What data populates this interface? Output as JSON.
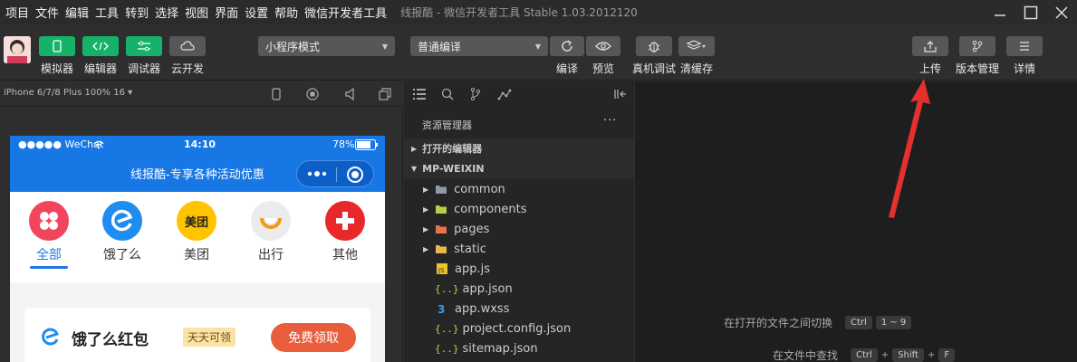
{
  "menubar": {
    "items": [
      "项目",
      "文件",
      "编辑",
      "工具",
      "转到",
      "选择",
      "视图",
      "界面",
      "设置",
      "帮助",
      "微信开发者工具"
    ],
    "window_title": "线报酷 - 微信开发者工具 Stable 1.03.2012120"
  },
  "toolbar": {
    "left_buttons": [
      {
        "label": "模拟器",
        "icon": "phone-icon",
        "color": "#17b26a"
      },
      {
        "label": "编辑器",
        "icon": "code-icon",
        "color": "#17b26a"
      },
      {
        "label": "调试器",
        "icon": "debug-icon",
        "color": "#17b26a"
      },
      {
        "label": "云开发",
        "icon": "cloud-icon",
        "color": "#575757"
      }
    ],
    "mode_select": "小程序模式",
    "compile_select": "普通编译",
    "action_buttons": [
      "编译",
      "预览",
      "真机调试",
      "清缓存"
    ],
    "right_buttons": [
      "上传",
      "版本管理",
      "详情"
    ]
  },
  "simulator": {
    "device": "iPhone 6/7/8 Plus 100% 16 ▾",
    "status": {
      "carrier": "●●●●● WeChat",
      "time": "14:10",
      "battery": "78%"
    },
    "nav_title": "线报酷-专享各种活动优惠",
    "categories": [
      {
        "label": "全部",
        "icon": "all-icon",
        "color": "#f0455c"
      },
      {
        "label": "饿了么",
        "icon": "eleme-icon",
        "color": "#1e8cf0"
      },
      {
        "label": "美团",
        "icon": "meituan-icon",
        "color": "#ffc300",
        "text": "美团"
      },
      {
        "label": "出行",
        "icon": "didi-icon",
        "color": "#f4f4f4"
      },
      {
        "label": "其他",
        "icon": "plus-icon",
        "color": "#e8282b"
      }
    ],
    "card": {
      "title": "饿了么红包",
      "badge": "天天可领",
      "button": "免费领取"
    }
  },
  "explorer": {
    "title": "资源管理器",
    "more": "···",
    "sections": [
      "打开的编辑器",
      "MP-WEIXIN"
    ],
    "tree": [
      {
        "name": "common",
        "type": "folder",
        "color": "#8a9aa8"
      },
      {
        "name": "components",
        "type": "folder",
        "color": "#b5d04a"
      },
      {
        "name": "pages",
        "type": "folder",
        "color": "#e8754a"
      },
      {
        "name": "static",
        "type": "folder",
        "color": "#e8b94a"
      },
      {
        "name": "app.js",
        "type": "js"
      },
      {
        "name": "app.json",
        "type": "json"
      },
      {
        "name": "app.wxss",
        "type": "css"
      },
      {
        "name": "project.config.json",
        "type": "json"
      },
      {
        "name": "sitemap.json",
        "type": "json"
      }
    ]
  },
  "editor_hints": [
    {
      "text": "在打开的文件之间切换",
      "keys": [
        "Ctrl",
        "1 ~ 9"
      ]
    },
    {
      "text": "在文件中查找",
      "keys": [
        "Ctrl",
        "+",
        "Shift",
        "+",
        "F"
      ]
    }
  ],
  "annotation": {
    "color": "#e53030"
  }
}
